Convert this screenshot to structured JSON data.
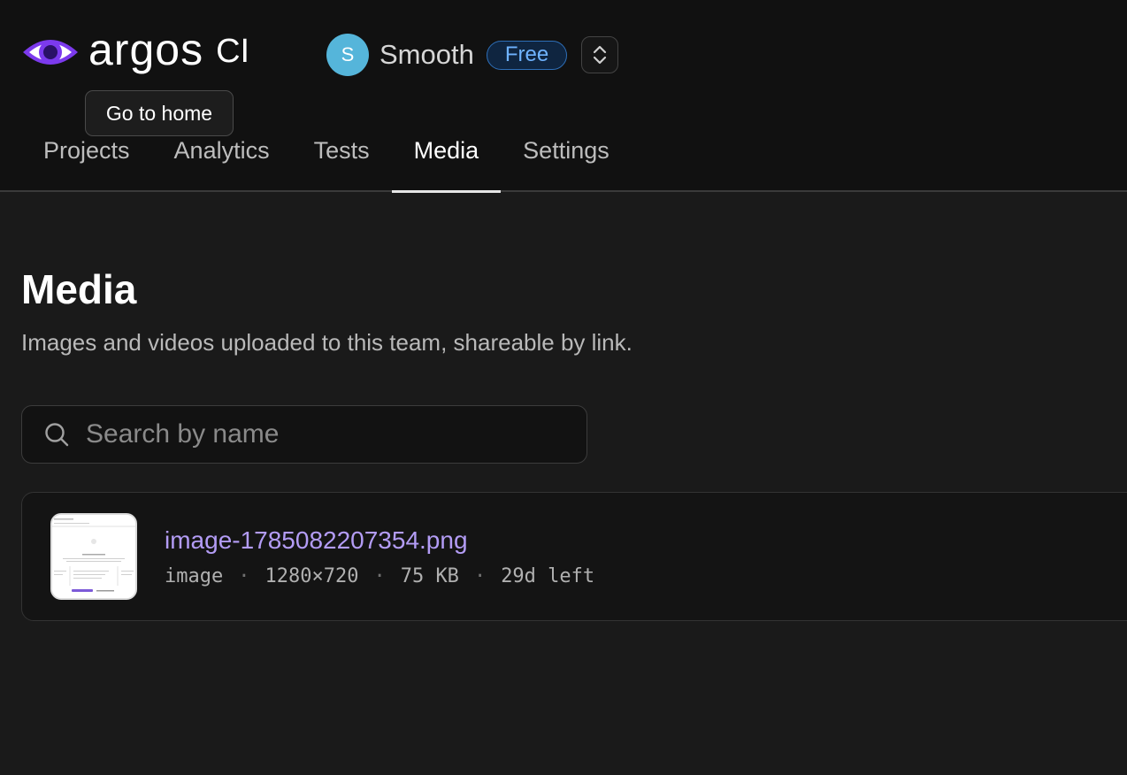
{
  "brand": {
    "name": "argos",
    "suffix": "CI",
    "tooltip": "Go to home",
    "accent": "#8b5cf6"
  },
  "team": {
    "initial": "S",
    "name": "Smooth",
    "plan": "Free",
    "avatar_color": "#55b5da"
  },
  "tabs": [
    {
      "label": "Projects",
      "active": false
    },
    {
      "label": "Analytics",
      "active": false
    },
    {
      "label": "Tests",
      "active": false
    },
    {
      "label": "Media",
      "active": true
    },
    {
      "label": "Settings",
      "active": false
    }
  ],
  "page": {
    "title": "Media",
    "subtitle": "Images and videos uploaded to this team, shareable by link."
  },
  "search": {
    "placeholder": "Search by name",
    "value": ""
  },
  "media": [
    {
      "name": "image-1785082207354.png",
      "type": "image",
      "dimensions": "1280×720",
      "size": "75 KB",
      "expires": "29d left",
      "separator": "·"
    }
  ]
}
